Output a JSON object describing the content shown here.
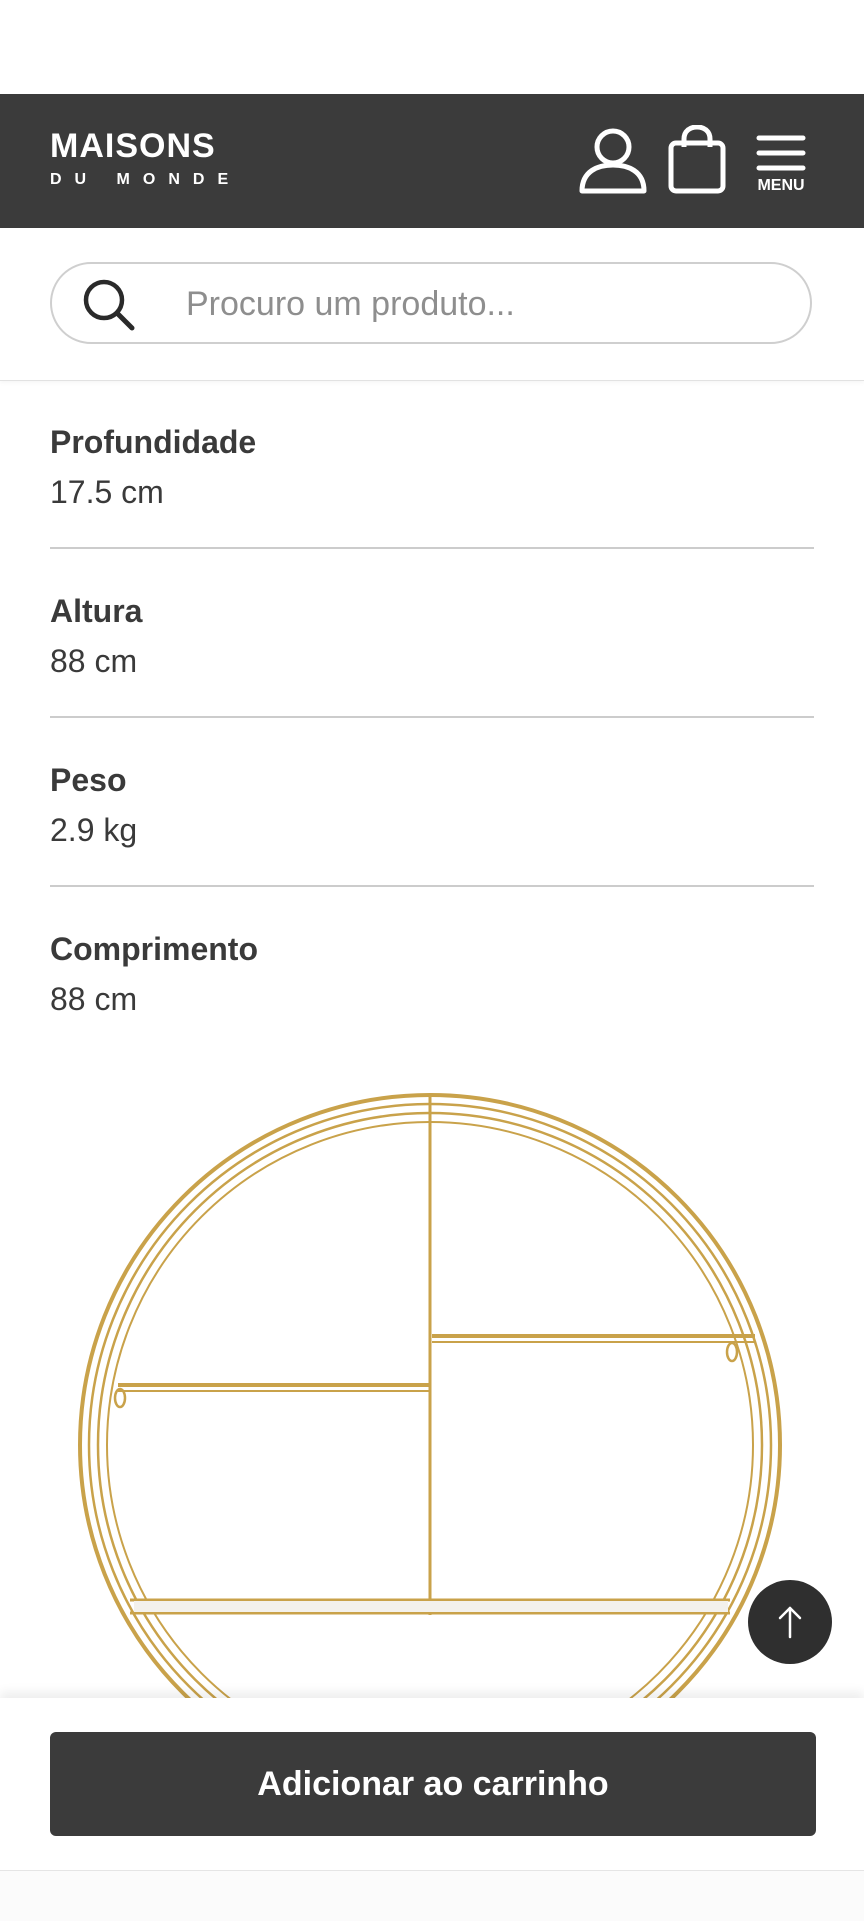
{
  "header": {
    "logo_main": "MAISONS",
    "logo_sub": "DU MONDE",
    "menu_label": "MENU",
    "icons": [
      "account-icon",
      "shopping-bag-icon",
      "hamburger-menu-icon"
    ]
  },
  "search": {
    "placeholder": "Procuro um produto..."
  },
  "specs": [
    {
      "label": "Profundidade",
      "value": "17.5 cm"
    },
    {
      "label": "Altura",
      "value": "88 cm"
    },
    {
      "label": "Peso",
      "value": "2.9 kg"
    },
    {
      "label": "Comprimento",
      "value": "88 cm"
    }
  ],
  "product_image": {
    "icon": "round-gold-wall-shelf-image"
  },
  "actions": {
    "add_to_cart_label": "Adicionar ao carrinho",
    "scroll_top_icon": "arrow-up-icon"
  },
  "colors": {
    "header_bg": "#3b3b3b",
    "button_bg": "#3b3b3b",
    "gold": "#c9a24a"
  }
}
